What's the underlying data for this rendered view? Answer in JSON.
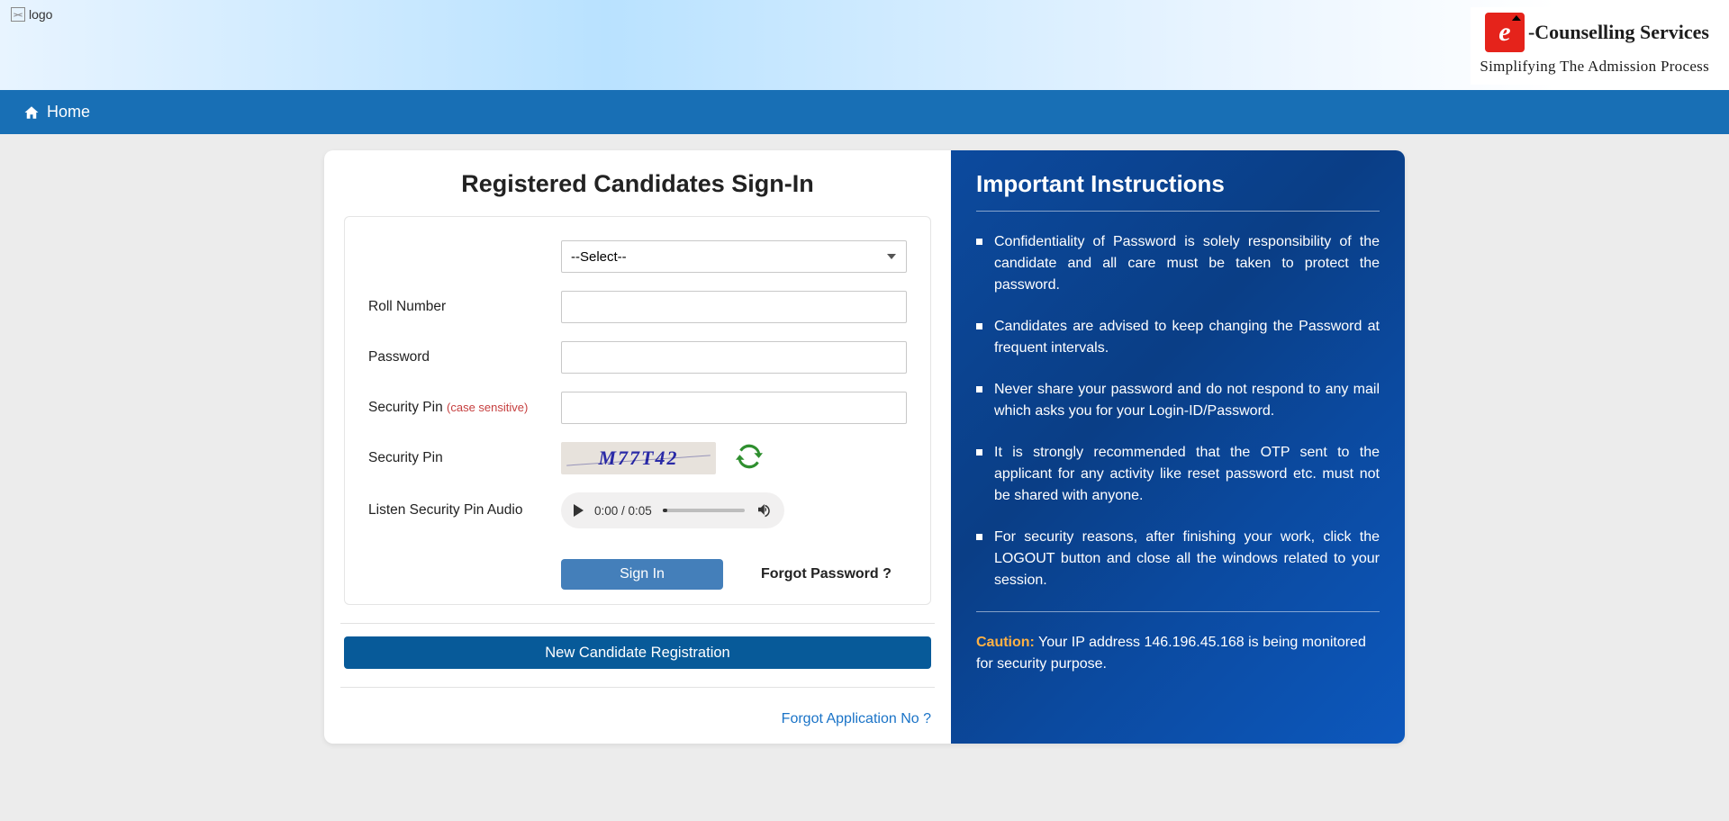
{
  "header": {
    "logo_alt": "logo",
    "service_brand_prefix": "-Counselling Services",
    "service_tagline": "Simplifying The Admission Process",
    "e_letter": "e"
  },
  "nav": {
    "home": "Home"
  },
  "left": {
    "title": "Registered Candidates Sign-In",
    "select_placeholder": "--Select--",
    "labels": {
      "roll": "Roll Number",
      "password": "Password",
      "pin_input": "Security Pin",
      "pin_hint": "(case sensitive)",
      "pin_display": "Security Pin",
      "audio": "Listen Security Pin Audio"
    },
    "captcha": "M77T42",
    "audio_time": "0:00 / 0:05",
    "signin": "Sign In",
    "forgot_pw": "Forgot Password ?",
    "new_reg": "New Candidate Registration",
    "forgot_app": "Forgot Application No ?"
  },
  "right": {
    "title": "Important Instructions",
    "items": [
      "Confidentiality of Password is solely responsibility of the candidate and all care must be taken to protect the password.",
      "Candidates are advised to keep changing the Password at frequent intervals.",
      "Never share your password and do not respond to any mail which asks you for your Login-ID/Password.",
      "It is strongly recommended that the OTP sent to the applicant for any activity like reset password etc. must not be shared with anyone.",
      "For security reasons, after finishing your work, click the LOGOUT button and close all the windows related to your session."
    ],
    "caution_label": "Caution:",
    "caution_text": " Your IP address 146.196.45.168 is being monitored for security purpose."
  }
}
